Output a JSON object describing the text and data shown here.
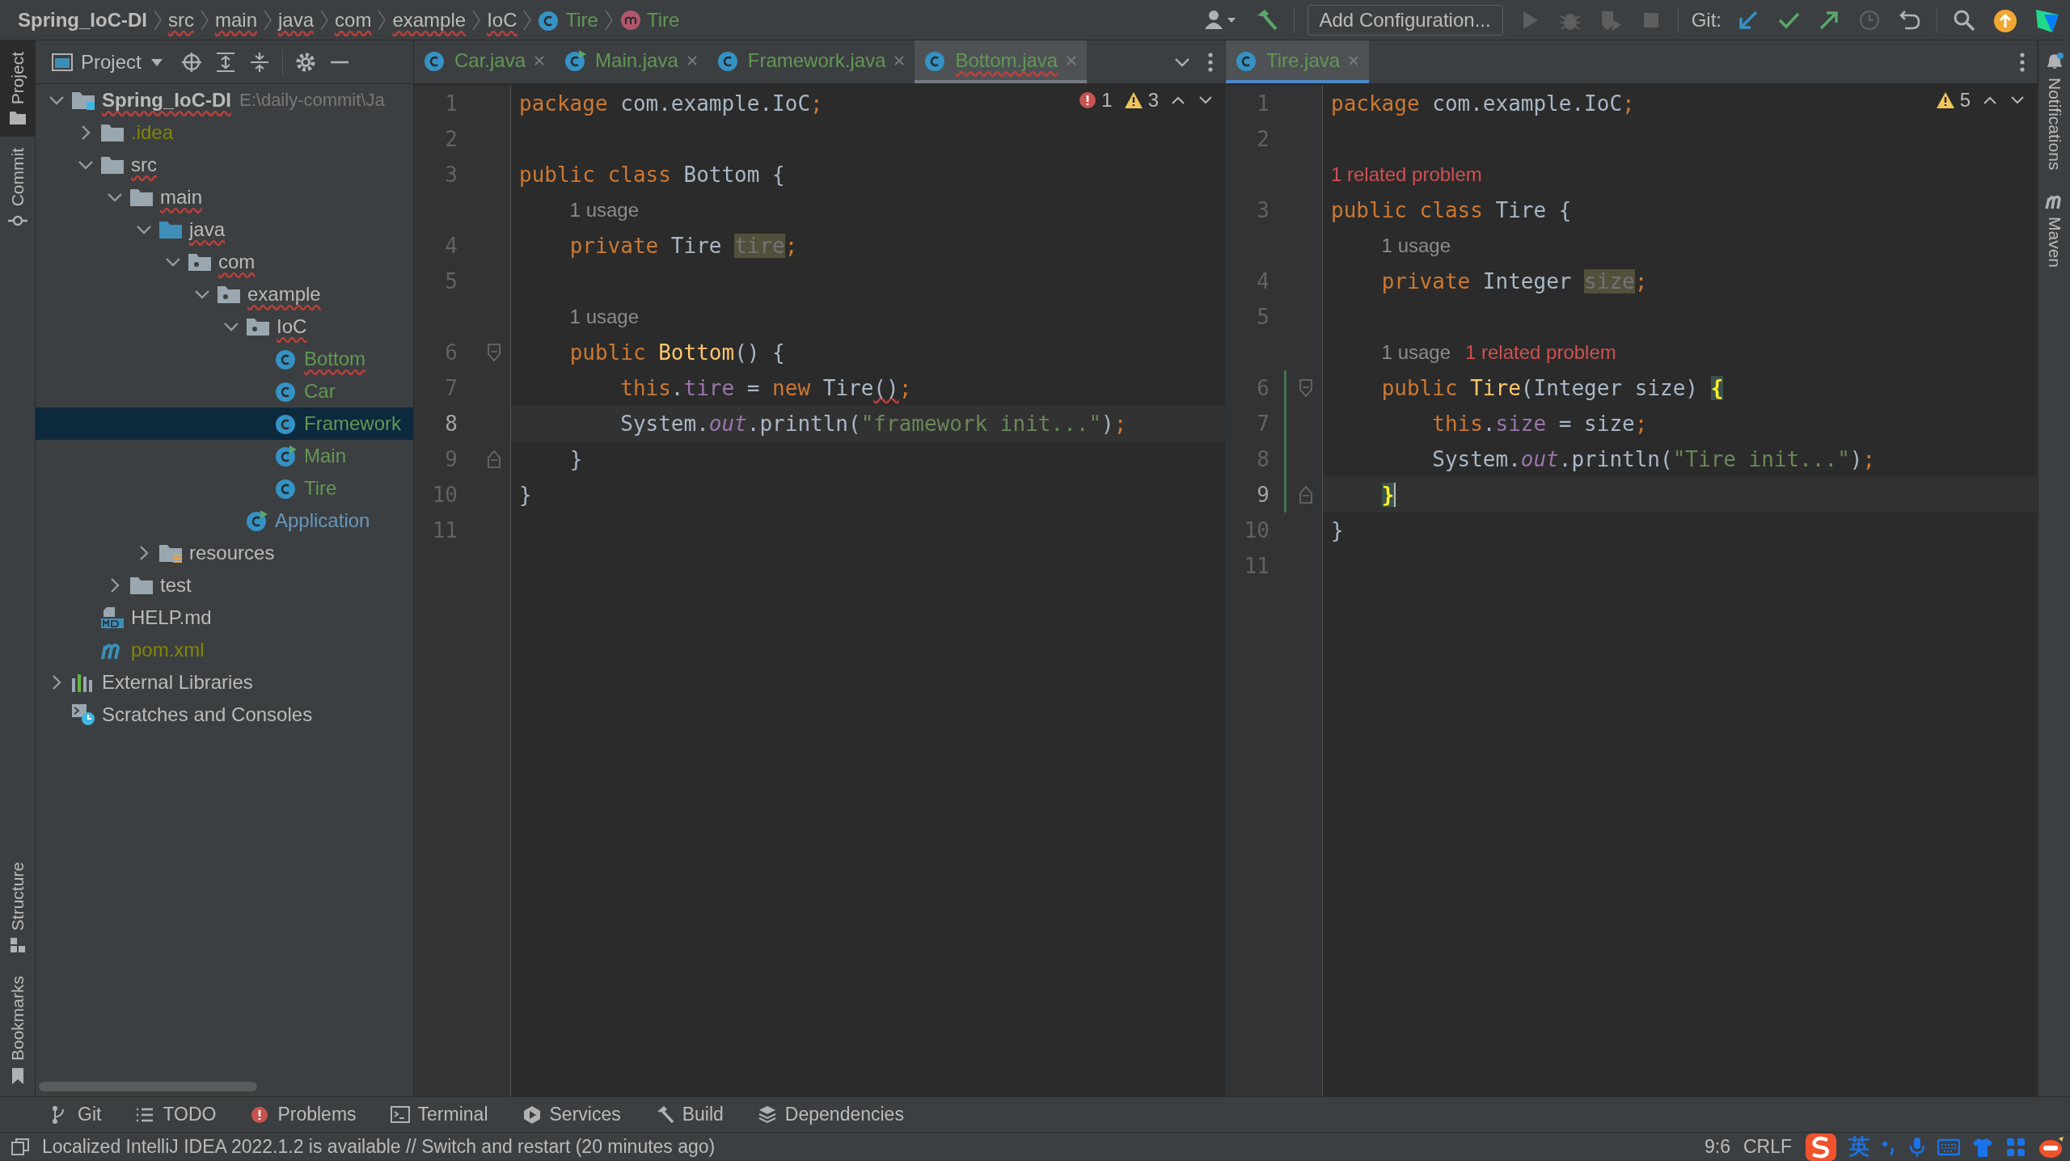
{
  "breadcrumbs": [
    {
      "label": "Spring_IoC-DI",
      "bold": true,
      "underlined": false
    },
    {
      "label": "src",
      "bold": false,
      "underlined": true
    },
    {
      "label": "main",
      "bold": false,
      "underlined": true
    },
    {
      "label": "java",
      "bold": false,
      "underlined": true
    },
    {
      "label": "com",
      "bold": false,
      "underlined": true
    },
    {
      "label": "example",
      "bold": false,
      "underlined": true
    },
    {
      "label": "IoC",
      "bold": false,
      "underlined": true
    },
    {
      "label": "Tire",
      "kind": "class",
      "bold": false,
      "underlined": false
    },
    {
      "label": "Tire",
      "kind": "method",
      "bold": false,
      "underlined": false
    }
  ],
  "toolbar": {
    "actions_left": [
      {
        "kind": "user",
        "disabled": false
      },
      {
        "kind": "build",
        "disabled": false
      }
    ],
    "run_config": "Add Configuration...",
    "actions_run": [
      {
        "kind": "run",
        "disabled": true
      },
      {
        "kind": "debug",
        "disabled": true
      },
      {
        "kind": "coverage",
        "disabled": true
      },
      {
        "kind": "stop",
        "disabled": true
      }
    ],
    "git_label": "Git:",
    "actions_git": [
      {
        "kind": "update",
        "disabled": false
      },
      {
        "kind": "commit",
        "disabled": false
      },
      {
        "kind": "push",
        "disabled": false
      },
      {
        "kind": "history",
        "disabled": true
      },
      {
        "kind": "rollback",
        "disabled": false
      }
    ],
    "actions_right": [
      {
        "kind": "search",
        "disabled": false
      },
      {
        "kind": "ide-update",
        "disabled": false
      },
      {
        "kind": "toolbox",
        "disabled": false
      }
    ]
  },
  "left_strip": {
    "top": [
      {
        "label": "Project",
        "kind": "folder",
        "selected": true
      },
      {
        "label": "Commit",
        "kind": "commit",
        "selected": false
      }
    ],
    "bottom": [
      {
        "label": "Structure",
        "kind": "structure",
        "selected": false
      },
      {
        "label": "Bookmarks",
        "kind": "bookmark",
        "selected": false
      }
    ]
  },
  "right_strip": [
    {
      "label": "Notifications",
      "kind": "bell"
    },
    {
      "label": "Maven",
      "kind": "maven"
    }
  ],
  "project": {
    "title": "Project",
    "tree": [
      {
        "label": "Spring_IoC-DI",
        "path": "E:\\daily-commit\\Ja",
        "kind": "module",
        "underlined": true,
        "bold": true,
        "selected": false,
        "expanded": true,
        "children": [
          {
            "label": ".idea",
            "kind": "folder",
            "color": "#848504",
            "underlined": false,
            "selected": false,
            "expanded": false
          },
          {
            "label": "src",
            "kind": "folder",
            "underlined": true,
            "selected": false,
            "expanded": true,
            "children": [
              {
                "label": "main",
                "kind": "folder",
                "underlined": true,
                "selected": false,
                "expanded": true,
                "children": [
                  {
                    "label": "java",
                    "kind": "source-folder",
                    "underlined": true,
                    "selected": false,
                    "expanded": true,
                    "children": [
                      {
                        "label": "com",
                        "kind": "package",
                        "underlined": true,
                        "selected": false,
                        "expanded": true,
                        "children": [
                          {
                            "label": "example",
                            "kind": "package",
                            "underlined": true,
                            "selected": false,
                            "expanded": true,
                            "children": [
                              {
                                "label": "IoC",
                                "kind": "package",
                                "underlined": true,
                                "selected": false,
                                "expanded": true,
                                "children": [
                                  {
                                    "label": "Bottom",
                                    "kind": "class",
                                    "color": "#629755",
                                    "underlined": true,
                                    "selected": false
                                  },
                                  {
                                    "label": "Car",
                                    "kind": "class",
                                    "color": "#629755",
                                    "underlined": false,
                                    "selected": false
                                  },
                                  {
                                    "label": "Framework",
                                    "kind": "class",
                                    "color": "#629755",
                                    "underlined": false,
                                    "selected": true
                                  },
                                  {
                                    "label": "Main",
                                    "kind": "main-class",
                                    "color": "#629755",
                                    "underlined": false,
                                    "selected": false
                                  },
                                  {
                                    "label": "Tire",
                                    "kind": "class",
                                    "color": "#629755",
                                    "underlined": false,
                                    "selected": false
                                  }
                                ]
                              },
                              {
                                "label": "Application",
                                "kind": "main-class",
                                "color": "#6897bb",
                                "underlined": false,
                                "selected": false
                              }
                            ]
                          }
                        ]
                      }
                    ]
                  },
                  {
                    "label": "resources",
                    "kind": "resources",
                    "underlined": false,
                    "selected": false,
                    "expanded": false
                  }
                ]
              },
              {
                "label": "test",
                "kind": "folder",
                "underlined": false,
                "selected": false,
                "expanded": false
              }
            ]
          },
          {
            "label": "HELP.md",
            "kind": "markdown",
            "underlined": false,
            "selected": false
          },
          {
            "label": "pom.xml",
            "kind": "maven",
            "color": "#848504",
            "underlined": false,
            "selected": false
          }
        ]
      },
      {
        "label": "External Libraries",
        "kind": "libraries",
        "underlined": false,
        "selected": false,
        "expanded": false
      },
      {
        "label": "Scratches and Consoles",
        "kind": "scratches",
        "underlined": false,
        "selected": false
      }
    ]
  },
  "editors": [
    {
      "tabs": [
        {
          "label": "Car.java",
          "kind": "class",
          "selected": false,
          "underlined": false
        },
        {
          "label": "Main.java",
          "kind": "main-class",
          "selected": false,
          "underlined": false
        },
        {
          "label": "Framework.java",
          "kind": "class",
          "selected": false,
          "underlined": false
        },
        {
          "label": "Bottom.java",
          "kind": "class",
          "selected": true,
          "underlined": true
        }
      ],
      "focused": false,
      "errors": "1",
      "warnings": "3",
      "rows": [
        {
          "kind": "code",
          "number": "1",
          "current": false,
          "changed": false,
          "caret": false,
          "tokens": [
            {
              "kind": "keyword",
              "text": "package"
            },
            {
              "kind": "plain",
              "text": " com.example.IoC"
            },
            {
              "kind": "keyword",
              "text": ";"
            }
          ]
        },
        {
          "kind": "code",
          "number": "2",
          "current": false,
          "changed": false,
          "caret": false
        },
        {
          "kind": "code",
          "number": "3",
          "current": false,
          "changed": false,
          "caret": false,
          "tokens": [
            {
              "kind": "keyword",
              "text": "public class"
            },
            {
              "kind": "plain",
              "text": " Bottom {"
            }
          ]
        },
        {
          "kind": "inlay",
          "hints": [
            {
              "kind": "usage",
              "text": "1 usage"
            }
          ]
        },
        {
          "kind": "code",
          "number": "4",
          "current": false,
          "changed": false,
          "caret": false,
          "tokens": [
            {
              "kind": "keyword",
              "text": "    private"
            },
            {
              "kind": "plain",
              "text": " Tire "
            },
            {
              "kind": "unused",
              "text": "tire"
            },
            {
              "kind": "keyword",
              "text": ";"
            }
          ]
        },
        {
          "kind": "code",
          "number": "5",
          "current": false,
          "changed": false,
          "caret": false
        },
        {
          "kind": "inlay",
          "hints": [
            {
              "kind": "usage",
              "text": "1 usage"
            }
          ]
        },
        {
          "kind": "code",
          "number": "6",
          "current": false,
          "changed": false,
          "fold_start": true,
          "caret": false,
          "tokens": [
            {
              "kind": "keyword",
              "text": "    public"
            },
            {
              "kind": "method",
              "text": " Bottom"
            },
            {
              "kind": "plain",
              "text": "() {"
            }
          ]
        },
        {
          "kind": "code",
          "number": "7",
          "current": false,
          "changed": false,
          "caret": false,
          "tokens": [
            {
              "kind": "keyword",
              "text": "        this"
            },
            {
              "kind": "plain",
              "text": "."
            },
            {
              "kind": "field",
              "text": "tire"
            },
            {
              "kind": "plain",
              "text": " = "
            },
            {
              "kind": "keyword",
              "text": "new"
            },
            {
              "kind": "plain",
              "text": " Tire"
            },
            {
              "kind": "error",
              "text": "()"
            },
            {
              "kind": "keyword",
              "text": ";"
            }
          ]
        },
        {
          "kind": "code",
          "number": "8",
          "current": true,
          "changed": false,
          "caret": false,
          "tokens": [
            {
              "kind": "plain",
              "text": "        System."
            },
            {
              "kind": "static",
              "text": "out"
            },
            {
              "kind": "plain",
              "text": ".println("
            },
            {
              "kind": "string",
              "text": "\"framework init...\""
            },
            {
              "kind": "plain",
              "text": ")"
            },
            {
              "kind": "keyword",
              "text": ";"
            }
          ]
        },
        {
          "kind": "code",
          "number": "9",
          "current": false,
          "changed": false,
          "fold_end": true,
          "caret": false,
          "tokens": [
            {
              "kind": "plain",
              "text": "    }"
            }
          ]
        },
        {
          "kind": "code",
          "number": "10",
          "current": false,
          "changed": false,
          "caret": false,
          "tokens": [
            {
              "kind": "plain",
              "text": "}"
            }
          ]
        },
        {
          "kind": "code",
          "number": "11",
          "current": false,
          "changed": false,
          "caret": false
        }
      ]
    },
    {
      "tabs": [
        {
          "label": "Tire.java",
          "kind": "class",
          "selected": true,
          "underlined": false
        }
      ],
      "focused": true,
      "warnings": "5",
      "rows": [
        {
          "kind": "code",
          "number": "1",
          "current": false,
          "changed": false,
          "caret": false,
          "tokens": [
            {
              "kind": "keyword",
              "text": "package"
            },
            {
              "kind": "plain",
              "text": " com.example.IoC"
            },
            {
              "kind": "keyword",
              "text": ";"
            }
          ]
        },
        {
          "kind": "code",
          "number": "2",
          "current": false,
          "changed": false,
          "caret": false
        },
        {
          "kind": "inlay",
          "hints": [
            {
              "kind": "problem",
              "text": "1 related problem"
            }
          ]
        },
        {
          "kind": "code",
          "number": "3",
          "current": false,
          "changed": false,
          "caret": false,
          "tokens": [
            {
              "kind": "keyword",
              "text": "public class"
            },
            {
              "kind": "plain",
              "text": " Tire {"
            }
          ]
        },
        {
          "kind": "inlay",
          "hints": [
            {
              "kind": "usage",
              "text": "1 usage"
            }
          ]
        },
        {
          "kind": "code",
          "number": "4",
          "current": false,
          "changed": false,
          "caret": false,
          "tokens": [
            {
              "kind": "keyword",
              "text": "    private"
            },
            {
              "kind": "plain",
              "text": " Integer "
            },
            {
              "kind": "unused",
              "text": "size"
            },
            {
              "kind": "keyword",
              "text": ";"
            }
          ]
        },
        {
          "kind": "code",
          "number": "5",
          "current": false,
          "changed": false,
          "caret": false
        },
        {
          "kind": "inlay",
          "hints": [
            {
              "kind": "usage",
              "text": "1 usage"
            },
            {
              "kind": "problem",
              "text": "1 related problem"
            }
          ]
        },
        {
          "kind": "code",
          "number": "6",
          "current": false,
          "changed": true,
          "fold_start": true,
          "caret": false,
          "tokens": [
            {
              "kind": "keyword",
              "text": "    public"
            },
            {
              "kind": "method",
              "text": " Tire"
            },
            {
              "kind": "plain",
              "text": "(Integer size) "
            },
            {
              "kind": "brace",
              "text": "{"
            }
          ]
        },
        {
          "kind": "code",
          "number": "7",
          "current": false,
          "changed": true,
          "caret": false,
          "tokens": [
            {
              "kind": "keyword",
              "text": "        this"
            },
            {
              "kind": "plain",
              "text": "."
            },
            {
              "kind": "field",
              "text": "size"
            },
            {
              "kind": "plain",
              "text": " = size"
            },
            {
              "kind": "keyword",
              "text": ";"
            }
          ]
        },
        {
          "kind": "code",
          "number": "8",
          "current": false,
          "changed": true,
          "caret": false,
          "tokens": [
            {
              "kind": "plain",
              "text": "        System."
            },
            {
              "kind": "static",
              "text": "out"
            },
            {
              "kind": "plain",
              "text": ".println("
            },
            {
              "kind": "string",
              "text": "\"Tire init...\""
            },
            {
              "kind": "plain",
              "text": ")"
            },
            {
              "kind": "keyword",
              "text": ";"
            }
          ]
        },
        {
          "kind": "code",
          "number": "9",
          "current": true,
          "changed": true,
          "fold_end": true,
          "caret": true,
          "tokens": [
            {
              "kind": "brace",
              "text": "    }"
            }
          ]
        },
        {
          "kind": "code",
          "number": "10",
          "current": false,
          "changed": false,
          "caret": false,
          "tokens": [
            {
              "kind": "plain",
              "text": "}"
            }
          ]
        },
        {
          "kind": "code",
          "number": "11",
          "current": false,
          "changed": false,
          "caret": false
        }
      ]
    }
  ],
  "tool_windows": [
    {
      "label": "Git",
      "kind": "branch"
    },
    {
      "label": "TODO",
      "kind": "list"
    },
    {
      "label": "Problems",
      "kind": "problem"
    },
    {
      "label": "Terminal",
      "kind": "terminal"
    },
    {
      "label": "Services",
      "kind": "services"
    },
    {
      "label": "Build",
      "kind": "build"
    },
    {
      "label": "Dependencies",
      "kind": "layers"
    }
  ],
  "status_bar": {
    "message": "Localized IntelliJ IDEA 2022.1.2 is available // Switch and restart (20 minutes ago)",
    "position": "9:6",
    "line_separator": "CRLF",
    "ime_mode": "英"
  }
}
